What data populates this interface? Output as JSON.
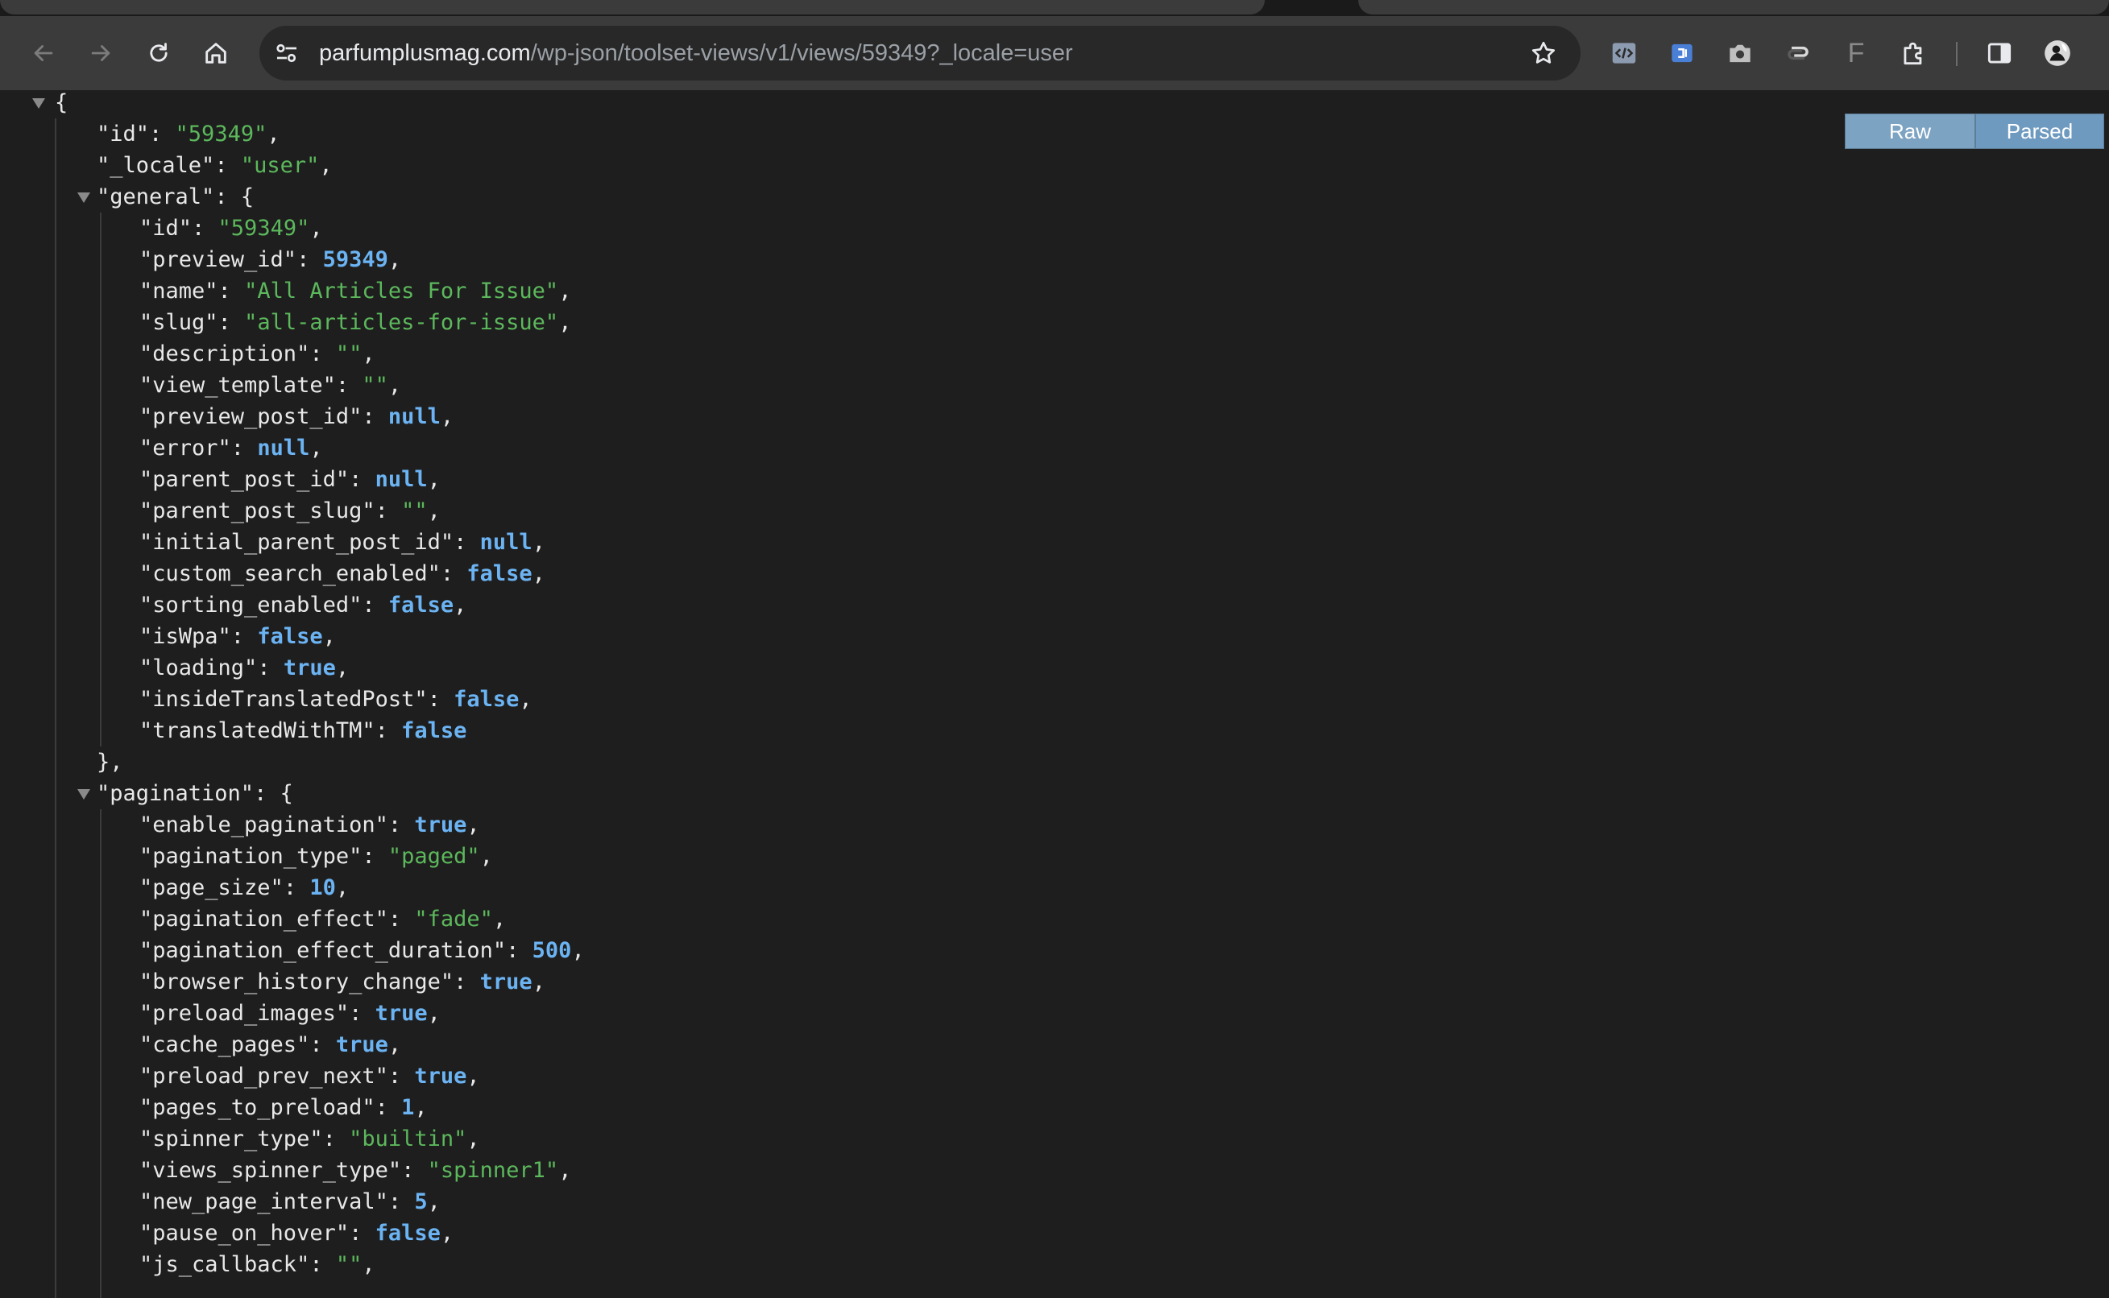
{
  "browser": {
    "url_host": "parfumplusmag.com",
    "url_path": "/wp-json/toolset-views/v1/views/59349?_locale=user",
    "nav": {
      "back_icon": "back-arrow-icon",
      "forward_icon": "forward-arrow-icon",
      "reload_icon": "reload-icon",
      "home_icon": "home-icon"
    },
    "extensions": [
      "code-view-icon",
      "translate-ext-icon",
      "camera-icon",
      "sync-ext-icon",
      "font-ext-icon",
      "puzzle-icon",
      "sidepanel-icon",
      "profile-avatar-icon"
    ],
    "extension_letter": "F"
  },
  "view_toggle": {
    "raw_label": "Raw",
    "parsed_label": "Parsed"
  },
  "json_lines": [
    {
      "t": [
        [
          "p",
          "{"
        ]
      ]
    },
    {
      "t": [
        [
          "k",
          "\"id\""
        ],
        [
          "p",
          ": "
        ],
        [
          "s",
          "\"59349\""
        ],
        [
          "p",
          ","
        ]
      ]
    },
    {
      "t": [
        [
          "k",
          "\"_locale\""
        ],
        [
          "p",
          ": "
        ],
        [
          "s",
          "\"user\""
        ],
        [
          "p",
          ","
        ]
      ]
    },
    {
      "t": [
        [
          "k",
          "\"general\""
        ],
        [
          "p",
          ": {"
        ]
      ]
    },
    {
      "t": [
        [
          "k",
          "\"id\""
        ],
        [
          "p",
          ": "
        ],
        [
          "s",
          "\"59349\""
        ],
        [
          "p",
          ","
        ]
      ]
    },
    {
      "t": [
        [
          "k",
          "\"preview_id\""
        ],
        [
          "p",
          ": "
        ],
        [
          "n",
          "59349"
        ],
        [
          "p",
          ","
        ]
      ]
    },
    {
      "t": [
        [
          "k",
          "\"name\""
        ],
        [
          "p",
          ": "
        ],
        [
          "s",
          "\"All Articles For Issue\""
        ],
        [
          "p",
          ","
        ]
      ]
    },
    {
      "t": [
        [
          "k",
          "\"slug\""
        ],
        [
          "p",
          ": "
        ],
        [
          "s",
          "\"all-articles-for-issue\""
        ],
        [
          "p",
          ","
        ]
      ]
    },
    {
      "t": [
        [
          "k",
          "\"description\""
        ],
        [
          "p",
          ": "
        ],
        [
          "s",
          "\"\""
        ],
        [
          "p",
          ","
        ]
      ]
    },
    {
      "t": [
        [
          "k",
          "\"view_template\""
        ],
        [
          "p",
          ": "
        ],
        [
          "s",
          "\"\""
        ],
        [
          "p",
          ","
        ]
      ]
    },
    {
      "t": [
        [
          "k",
          "\"preview_post_id\""
        ],
        [
          "p",
          ": "
        ],
        [
          "z",
          "null"
        ],
        [
          "p",
          ","
        ]
      ]
    },
    {
      "t": [
        [
          "k",
          "\"error\""
        ],
        [
          "p",
          ": "
        ],
        [
          "z",
          "null"
        ],
        [
          "p",
          ","
        ]
      ]
    },
    {
      "t": [
        [
          "k",
          "\"parent_post_id\""
        ],
        [
          "p",
          ": "
        ],
        [
          "z",
          "null"
        ],
        [
          "p",
          ","
        ]
      ]
    },
    {
      "t": [
        [
          "k",
          "\"parent_post_slug\""
        ],
        [
          "p",
          ": "
        ],
        [
          "s",
          "\"\""
        ],
        [
          "p",
          ","
        ]
      ]
    },
    {
      "t": [
        [
          "k",
          "\"initial_parent_post_id\""
        ],
        [
          "p",
          ": "
        ],
        [
          "z",
          "null"
        ],
        [
          "p",
          ","
        ]
      ]
    },
    {
      "t": [
        [
          "k",
          "\"custom_search_enabled\""
        ],
        [
          "p",
          ": "
        ],
        [
          "b",
          "false"
        ],
        [
          "p",
          ","
        ]
      ]
    },
    {
      "t": [
        [
          "k",
          "\"sorting_enabled\""
        ],
        [
          "p",
          ": "
        ],
        [
          "b",
          "false"
        ],
        [
          "p",
          ","
        ]
      ]
    },
    {
      "t": [
        [
          "k",
          "\"isWpa\""
        ],
        [
          "p",
          ": "
        ],
        [
          "b",
          "false"
        ],
        [
          "p",
          ","
        ]
      ]
    },
    {
      "t": [
        [
          "k",
          "\"loading\""
        ],
        [
          "p",
          ": "
        ],
        [
          "b",
          "true"
        ],
        [
          "p",
          ","
        ]
      ]
    },
    {
      "t": [
        [
          "k",
          "\"insideTranslatedPost\""
        ],
        [
          "p",
          ": "
        ],
        [
          "b",
          "false"
        ],
        [
          "p",
          ","
        ]
      ]
    },
    {
      "t": [
        [
          "k",
          "\"translatedWithTM\""
        ],
        [
          "p",
          ": "
        ],
        [
          "b",
          "false"
        ]
      ]
    },
    {
      "t": [
        [
          "p",
          "},"
        ]
      ]
    },
    {
      "t": [
        [
          "k",
          "\"pagination\""
        ],
        [
          "p",
          ": {"
        ]
      ]
    },
    {
      "t": [
        [
          "k",
          "\"enable_pagination\""
        ],
        [
          "p",
          ": "
        ],
        [
          "b",
          "true"
        ],
        [
          "p",
          ","
        ]
      ]
    },
    {
      "t": [
        [
          "k",
          "\"pagination_type\""
        ],
        [
          "p",
          ": "
        ],
        [
          "s",
          "\"paged\""
        ],
        [
          "p",
          ","
        ]
      ]
    },
    {
      "t": [
        [
          "k",
          "\"page_size\""
        ],
        [
          "p",
          ": "
        ],
        [
          "n",
          "10"
        ],
        [
          "p",
          ","
        ]
      ]
    },
    {
      "t": [
        [
          "k",
          "\"pagination_effect\""
        ],
        [
          "p",
          ": "
        ],
        [
          "s",
          "\"fade\""
        ],
        [
          "p",
          ","
        ]
      ]
    },
    {
      "t": [
        [
          "k",
          "\"pagination_effect_duration\""
        ],
        [
          "p",
          ": "
        ],
        [
          "n",
          "500"
        ],
        [
          "p",
          ","
        ]
      ]
    },
    {
      "t": [
        [
          "k",
          "\"browser_history_change\""
        ],
        [
          "p",
          ": "
        ],
        [
          "b",
          "true"
        ],
        [
          "p",
          ","
        ]
      ]
    },
    {
      "t": [
        [
          "k",
          "\"preload_images\""
        ],
        [
          "p",
          ": "
        ],
        [
          "b",
          "true"
        ],
        [
          "p",
          ","
        ]
      ]
    },
    {
      "t": [
        [
          "k",
          "\"cache_pages\""
        ],
        [
          "p",
          ": "
        ],
        [
          "b",
          "true"
        ],
        [
          "p",
          ","
        ]
      ]
    },
    {
      "t": [
        [
          "k",
          "\"preload_prev_next\""
        ],
        [
          "p",
          ": "
        ],
        [
          "b",
          "true"
        ],
        [
          "p",
          ","
        ]
      ]
    },
    {
      "t": [
        [
          "k",
          "\"pages_to_preload\""
        ],
        [
          "p",
          ": "
        ],
        [
          "n",
          "1"
        ],
        [
          "p",
          ","
        ]
      ]
    },
    {
      "t": [
        [
          "k",
          "\"spinner_type\""
        ],
        [
          "p",
          ": "
        ],
        [
          "s",
          "\"builtin\""
        ],
        [
          "p",
          ","
        ]
      ]
    },
    {
      "t": [
        [
          "k",
          "\"views_spinner_type\""
        ],
        [
          "p",
          ": "
        ],
        [
          "s",
          "\"spinner1\""
        ],
        [
          "p",
          ","
        ]
      ]
    },
    {
      "t": [
        [
          "k",
          "\"new_page_interval\""
        ],
        [
          "p",
          ": "
        ],
        [
          "n",
          "5"
        ],
        [
          "p",
          ","
        ]
      ]
    },
    {
      "t": [
        [
          "k",
          "\"pause_on_hover\""
        ],
        [
          "p",
          ": "
        ],
        [
          "b",
          "false"
        ],
        [
          "p",
          ","
        ]
      ]
    },
    {
      "t": [
        [
          "k",
          "\"js_callback\""
        ],
        [
          "p",
          ": "
        ],
        [
          "s",
          "\"\""
        ],
        [
          "p",
          ","
        ]
      ]
    }
  ],
  "colors": {
    "string": "#5cb85c",
    "number": "#6bb3f2",
    "background": "#1e1e1e",
    "toolbar": "#3b3b3b"
  }
}
